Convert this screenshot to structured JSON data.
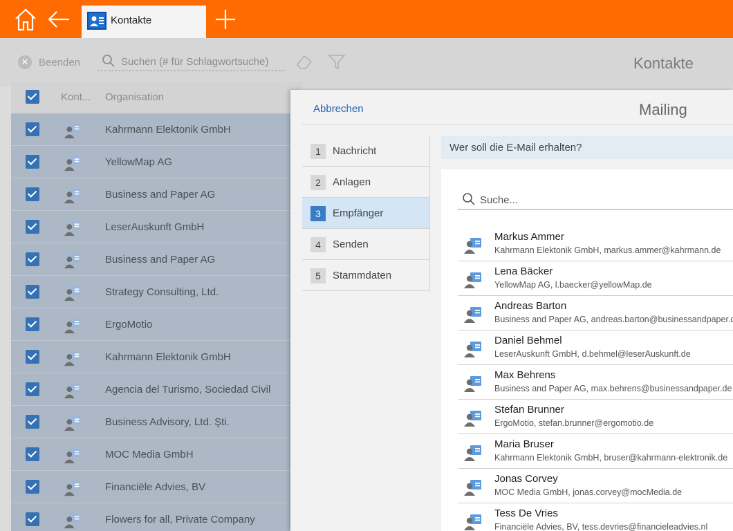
{
  "titlebar": {
    "home_icon": "home-icon",
    "back_icon": "arrow-left-icon",
    "tab_label": "Kontakte",
    "add_icon": "plus-icon",
    "color": "#ff6b00"
  },
  "toolbar": {
    "close_label": "Beenden",
    "search_placeholder": "Suchen (# für Schlagwortsuche)",
    "title": "Kontakte"
  },
  "list": {
    "columns": [
      "Kont...",
      "Organisation"
    ],
    "rows": [
      "Kahrmann Elektonik GmbH",
      "YellowMap AG",
      "Business and Paper AG",
      "LeserAuskunft GmbH",
      "Business and Paper AG",
      "Strategy Consulting, Ltd.",
      "ErgoMotio",
      "Kahrmann Elektonik GmbH",
      "Agencia del Turismo, Sociedad Civil",
      "Business Advisory, Ltd. Şti.",
      "MOC Media GmbH",
      "Financiële Advies, BV",
      "Flowers for all, Private Company"
    ]
  },
  "dialog": {
    "cancel_label": "Abbrechen",
    "title": "Mailing",
    "steps": [
      {
        "num": "1",
        "label": "Nachricht"
      },
      {
        "num": "2",
        "label": "Anlagen"
      },
      {
        "num": "3",
        "label": "Empfänger"
      },
      {
        "num": "4",
        "label": "Senden"
      },
      {
        "num": "5",
        "label": "Stammdaten"
      }
    ],
    "active_step": 3,
    "question": "Wer soll die E-Mail erhalten?",
    "search_placeholder": "Suche...",
    "contacts": [
      {
        "name": "Markus Ammer",
        "detail": "Kahrmann Elektonik GmbH, markus.ammer@kahrmann.de"
      },
      {
        "name": "Lena Bäcker",
        "detail": "YellowMap AG, l.baecker@yellowMap.de"
      },
      {
        "name": "Andreas Barton",
        "detail": "Business and Paper AG, andreas.barton@businessandpaper.de"
      },
      {
        "name": "Daniel Behmel",
        "detail": "LeserAuskunft GmbH, d.behmel@leserAuskunft.de"
      },
      {
        "name": "Max Behrens",
        "detail": "Business and Paper AG, max.behrens@businessandpaper.de"
      },
      {
        "name": "Stefan Brunner",
        "detail": "ErgoMotio, stefan.brunner@ergomotio.de"
      },
      {
        "name": "Maria Bruser",
        "detail": "Kahrmann Elektonik GmbH, bruser@kahrmann-elektronik.de"
      },
      {
        "name": "Jonas Corvey",
        "detail": "MOC Media GmbH, jonas.corvey@mocMedia.de"
      },
      {
        "name": "Tess De Vries",
        "detail": "Financiële Advies, BV, tess.devries@financieleadvies.nl"
      }
    ]
  }
}
